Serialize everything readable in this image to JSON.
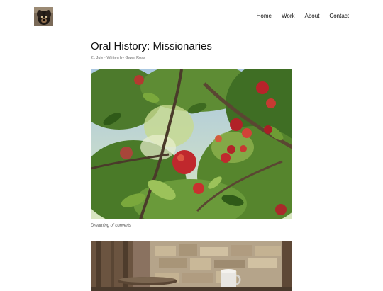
{
  "nav": {
    "items": [
      {
        "label": "Home"
      },
      {
        "label": "Work"
      },
      {
        "label": "About"
      },
      {
        "label": "Contact"
      }
    ],
    "active": "Work"
  },
  "post": {
    "title": "Oral History: Missionaries",
    "meta": "21 July · Written by Gwyn Ross",
    "caption": "Dreaming of converts"
  },
  "colors": {
    "text": "#111111",
    "meta": "#6b6b6b",
    "background": "#ffffff"
  },
  "icons": {
    "logo": "dog-portrait-image"
  }
}
